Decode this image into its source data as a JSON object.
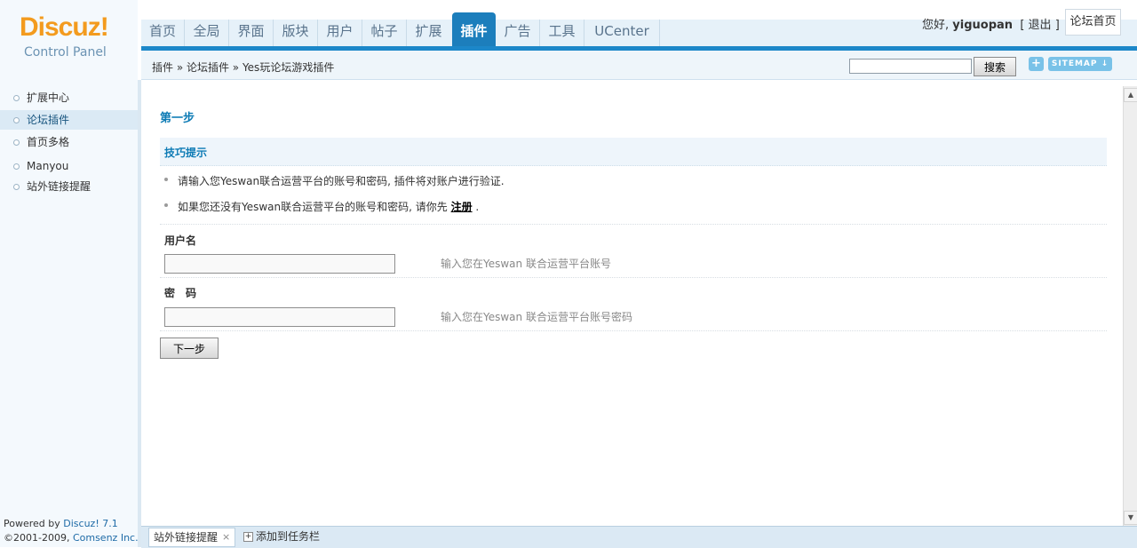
{
  "logo": {
    "brand": "Discuz!",
    "subtitle": "Control Panel"
  },
  "nav": {
    "tabs": [
      "首页",
      "全局",
      "界面",
      "版块",
      "用户",
      "帖子",
      "扩展",
      "插件",
      "广告",
      "工具",
      "UCenter"
    ],
    "active": "插件"
  },
  "user": {
    "greeting": "您好,",
    "name": "yiguopan",
    "open_bracket": "[",
    "logout": "退出",
    "close_bracket": "]",
    "home_button": "论坛首页"
  },
  "breadcrumb": "插件 » 论坛插件 » Yes玩论坛游戏插件",
  "search": {
    "button": "搜索",
    "plus": "+",
    "sitemap": "SITEMAP ↓"
  },
  "sidebar": {
    "items": [
      {
        "label": "扩展中心"
      },
      {
        "label": "论坛插件",
        "active": true
      },
      {
        "label": "首页多格"
      },
      {
        "label": "Manyou"
      },
      {
        "label": "站外链接提醒"
      }
    ]
  },
  "footer": {
    "powered_prefix": "Powered by ",
    "powered_brand": "Discuz! 7.1",
    "copyright_prefix": "©2001-2009, ",
    "copyright_brand": "Comsenz Inc."
  },
  "main": {
    "step_title": "第一步",
    "tips_title": "技巧提示",
    "tip1": "请输入您Yeswan联合运营平台的账号和密码, 插件将对账户进行验证.",
    "tip2_prefix": "如果您还没有Yeswan联合运营平台的账号和密码, 请你先 ",
    "tip2_link": "注册",
    "tip2_suffix": " .",
    "username_label": "用户名",
    "username_hint": "输入您在Yeswan 联合运营平台账号",
    "password_label": "密　码",
    "password_hint": "输入您在Yeswan 联合运营平台账号密码",
    "next_button": "下一步"
  },
  "taskbar": {
    "tab_label": "站外链接提醒",
    "tab_close": "×",
    "add_label": "添加到任务栏",
    "add_icon": "+"
  },
  "scrollbar": {
    "up": "▲",
    "down": "▼"
  },
  "colors": {
    "accent": "#1c87c9",
    "logo_orange": "#f39b1e",
    "heading_blue": "#0d7bb5"
  }
}
